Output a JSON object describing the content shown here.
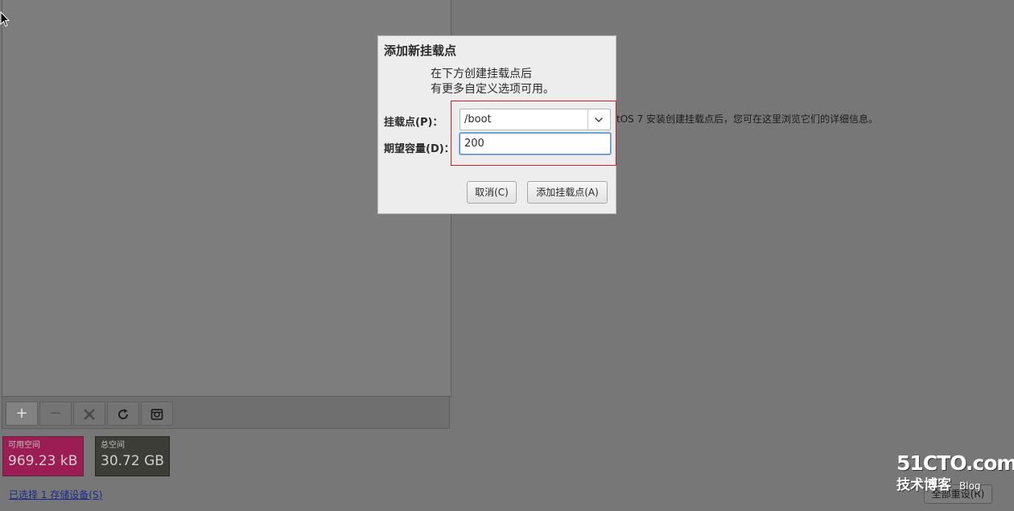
{
  "dialog": {
    "title": "添加新挂载点",
    "description_line1": "在下方创建挂载点后",
    "description_line2": "有更多自定义选项可用。",
    "mount_point_label": "挂载点(P)：",
    "mount_point_value": "/boot",
    "capacity_label": "期望容量(D)：",
    "capacity_value": "200",
    "cancel_label": "取消(C)",
    "add_label": "添加挂载点(A)"
  },
  "toolbar": {
    "add_symbol": "+",
    "remove_symbol": "−"
  },
  "space": {
    "free_label": "可用空间",
    "free_value": "969.23 kB",
    "total_label": "总空间",
    "total_value": "30.72 GB"
  },
  "storage_link": "已选择 1 存储设备(S)",
  "info_text": "tOS 7 安装创建挂载点后，您可在这里浏览它们的详细信息。",
  "reset_label": "全部重设(R)",
  "watermark": {
    "brand": "51CTO.com",
    "subtitle": "技术博客",
    "blog": "Blog"
  },
  "colors": {
    "free_space": "#9c1d54",
    "total_space": "#3b3d36",
    "highlight": "#d0202a",
    "focus": "#5c8fd1"
  },
  "icons": [
    "add-icon",
    "remove-icon",
    "configure-icon",
    "refresh-icon",
    "unlock-icon",
    "chevron-down-icon",
    "mouse-cursor-icon"
  ]
}
